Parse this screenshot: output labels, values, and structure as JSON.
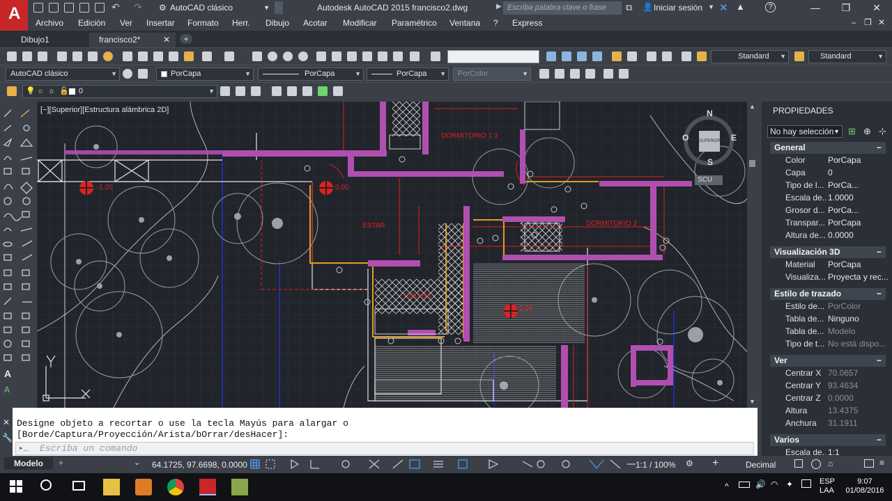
{
  "titlebar": {
    "workspace": "AutoCAD clásico",
    "window_title": "Autodesk AutoCAD 2015   francisco2.dwg",
    "search_placeholder": "Escriba palabra clave o frase",
    "signin": "Iniciar sesión"
  },
  "menu": [
    "Archivo",
    "Edición",
    "Ver",
    "Insertar",
    "Formato",
    "Herr.",
    "Dibujo",
    "Acotar",
    "Modificar",
    "Paramétrico",
    "Ventana",
    "?",
    "Express"
  ],
  "tabs": [
    {
      "label": "Dibujo1",
      "active": false
    },
    {
      "label": "francisco2*",
      "active": true
    }
  ],
  "toolbar2": {
    "workspace": "AutoCAD clásico",
    "color": "PorCapa",
    "linetype": "PorCapa",
    "lineweight": "PorCapa",
    "plotstyle": "PorColor",
    "textstyle": "Standard",
    "dimstyle": "Standard"
  },
  "toolbar3": {
    "layer": "0"
  },
  "drawing": {
    "view_label": "[−][Superior][Estructura alámbrica 2D]",
    "room_labels": [
      "DORMITORIO  1  3",
      "ESTAR",
      "DORMITORIO  2",
      "COCINA"
    ],
    "level_labels": [
      "-1.00",
      "0.00",
      "0.00"
    ],
    "compass": {
      "n": "N",
      "s": "S",
      "e": "E",
      "o": "O",
      "center": "SUPERIOR",
      "ucs": "SCU"
    }
  },
  "properties": {
    "title": "PROPIEDADES",
    "selection": "No hay selección",
    "sections": [
      {
        "title": "General",
        "rows": [
          [
            "Color",
            "PorCapa"
          ],
          [
            "Capa",
            "0"
          ],
          [
            "Tipo de l...",
            "PorCa..."
          ],
          [
            "Escala de...",
            "1.0000"
          ],
          [
            "Grosor d...",
            "PorCa..."
          ],
          [
            "Transpar...",
            "PorCapa"
          ],
          [
            "Altura de...",
            "0.0000"
          ]
        ]
      },
      {
        "title": "Visualización 3D",
        "rows": [
          [
            "Material",
            "PorCapa"
          ],
          [
            "Visualiza...",
            "Proyecta y rec..."
          ]
        ]
      },
      {
        "title": "Estilo de trazado",
        "rows": [
          [
            "Estilo de...",
            "PorColor"
          ],
          [
            "Tabla de...",
            "Ninguno"
          ],
          [
            "Tabla de...",
            "Modelo"
          ],
          [
            "Tipo de t...",
            "No está dispo..."
          ]
        ]
      },
      {
        "title": "Ver",
        "rows": [
          [
            "Centrar X",
            "70.0657"
          ],
          [
            "Centrar Y",
            "93.4634"
          ],
          [
            "Centrar Z",
            "0.0000"
          ],
          [
            "Altura",
            "13.4375"
          ],
          [
            "Anchura",
            "31.1911"
          ]
        ]
      },
      {
        "title": "Varios",
        "rows": [
          [
            "Escala de...",
            "1:1"
          ]
        ]
      }
    ]
  },
  "command": {
    "line1": "Designe objeto a recortar o use la tecla Mayús para alargar o",
    "line2": "[Borde/Captura/Proyección/Arista/bOrrar/desHacer]:",
    "placeholder": "Escriba un comando"
  },
  "status": {
    "model_tab": "Modelo",
    "coords": "64.1725, 97.6698, 0.0000",
    "scale": "1:1 / 100%",
    "units": "Decimal"
  },
  "taskbar": {
    "lang1": "ESP",
    "lang2": "LAA",
    "time": "9:07",
    "date": "01/08/2016"
  },
  "colors": {
    "accent": "#c8272a",
    "wall": "#b04fb0",
    "red_line": "#e02020",
    "orange": "#e0a020"
  }
}
